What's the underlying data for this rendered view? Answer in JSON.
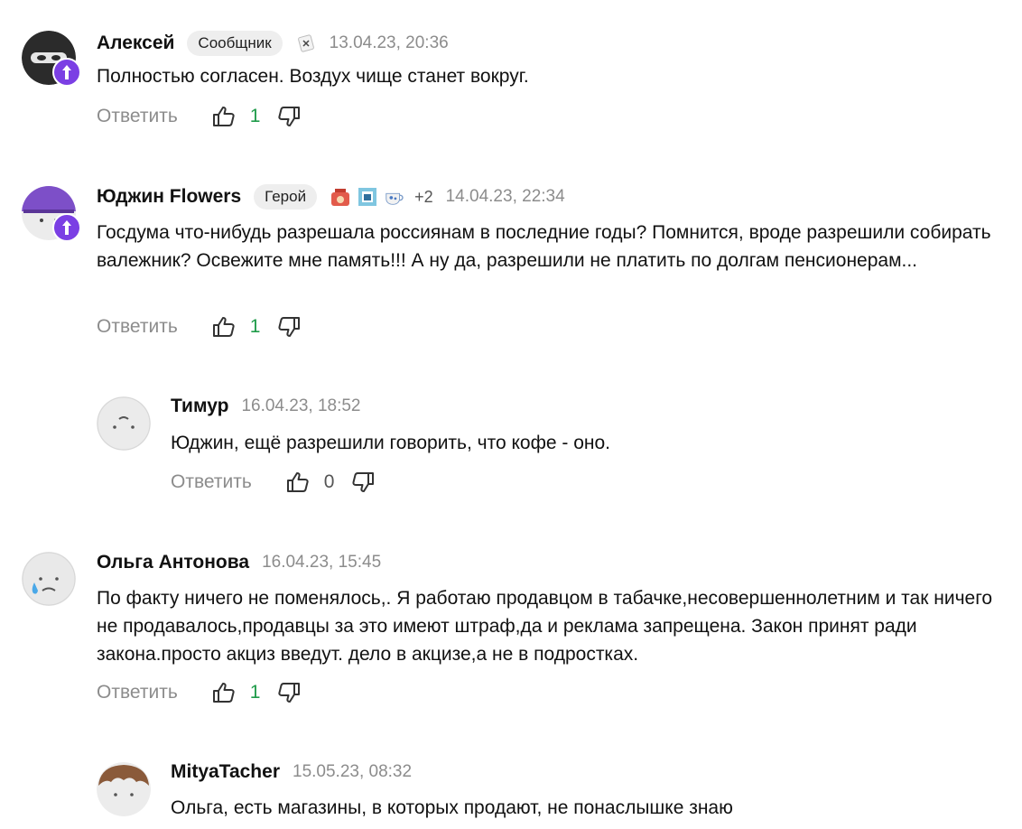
{
  "reply_label": "Ответить",
  "comments": [
    {
      "name": "Алексей",
      "role": "Сообщник",
      "date": "13.04.23, 20:36",
      "text": "Полностью согласен. Воздух чище станет вокруг.",
      "likes": "1",
      "avatar": "ninja-mask"
    },
    {
      "name": "Юджин Flowers",
      "role": "Герой",
      "stickers_more": "+2",
      "date": "14.04.23, 22:34",
      "text": "Госдума что-нибудь разрешала россиянам в последние годы? Помнится, вроде разрешили собирать валежник? Освежите мне память!!! А ну да, разрешили не платить по долгам пенсионерам...",
      "likes": "1",
      "avatar": "purple-hat"
    },
    {
      "name": "Тимур",
      "date": "16.04.23, 18:52",
      "text": "Юджин, ещё разрешили говорить, что кофе - оно.",
      "likes": "0",
      "avatar": "plain-face"
    },
    {
      "name": "Ольга Антонова",
      "date": "16.04.23, 15:45",
      "text": "По факту ничего не поменялось,. Я работаю продавцом в табачке,несовершеннолетним и так ничего не продавалось,продавцы за это имеют штраф,да и реклама запрещена. Закон принят ради закона.просто акциз введут. дело в акцизе,а не в подростках.",
      "likes": "1",
      "avatar": "crying-face"
    },
    {
      "name": "MityaTacher",
      "date": "15.05.23, 08:32",
      "text": "Ольга, есть магазины, в которых продают, не понаслышке знаю",
      "avatar": "brown-hair"
    }
  ],
  "colors": {
    "like_positive": "#1f9b4a",
    "muted": "#8c8c8c",
    "badge": "#7b3fe4"
  }
}
